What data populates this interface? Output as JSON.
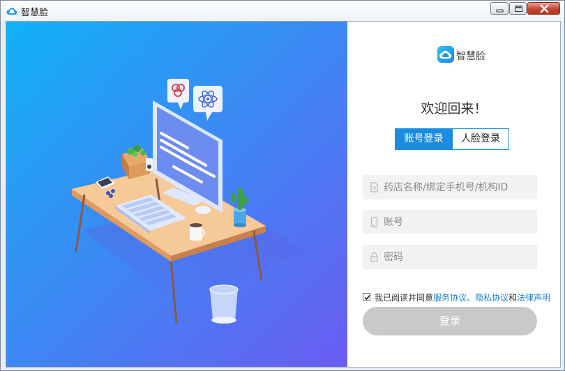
{
  "window": {
    "title": "智慧脸"
  },
  "brand": {
    "name": "智慧脸"
  },
  "welcome": "欢迎回来！",
  "tabs": [
    {
      "label": "账号登录",
      "active": true
    },
    {
      "label": "人脸登录",
      "active": false
    }
  ],
  "fields": {
    "store": {
      "placeholder": "药店名称/绑定手机号/机构ID",
      "value": ""
    },
    "account": {
      "placeholder": "账号",
      "value": ""
    },
    "password": {
      "placeholder": "密码",
      "value": ""
    }
  },
  "agreement": {
    "checked": true,
    "prefix": "我已阅读并同意",
    "service": "服务协议",
    "sep": "、",
    "privacy": "隐私协议",
    "and": "和",
    "legal": "法律声明"
  },
  "login_button": "登录",
  "colors": {
    "accent": "#1b8ce0",
    "link": "#1a7fc6",
    "button_disabled": "#c9c9c9",
    "illustration_start": "#10b2f6",
    "illustration_end": "#6b5cf2"
  },
  "icons": [
    "cloud-logo-icon",
    "minimize-icon",
    "maximize-icon",
    "close-icon",
    "document-icon",
    "phone-icon",
    "lock-icon",
    "checkmark-icon"
  ]
}
